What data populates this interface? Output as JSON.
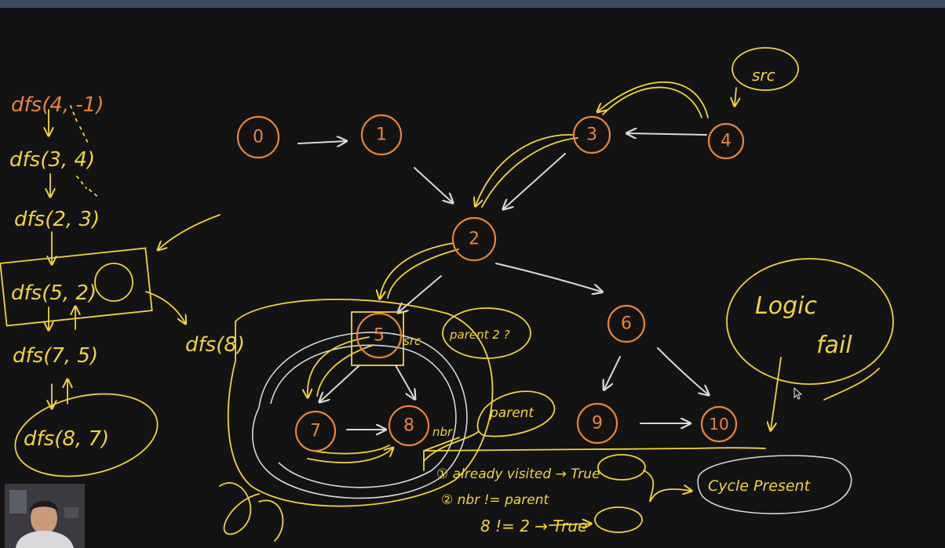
{
  "graph": {
    "nodes": [
      "0",
      "1",
      "2",
      "3",
      "4",
      "5",
      "6",
      "7",
      "8",
      "9",
      "10"
    ]
  },
  "annotations": {
    "src_label": "src",
    "dfs_calls": [
      "dfs(4, -1)",
      "dfs(3, 4)",
      "dfs(2, 3)",
      "dfs(5, 2)",
      "dfs(7, 5)",
      "dfs(8, 7)",
      "dfs(8)"
    ],
    "node5_src": "src",
    "parent_q": "parent 2 ?",
    "nbr_label": "nbr",
    "parent_label": "parent",
    "logic_fail": [
      "Logic",
      "fail"
    ],
    "conditions": [
      "① already visited → True",
      "② nbr != parent",
      "8 != 2 → True"
    ],
    "cycle_present": "Cycle Present"
  },
  "colors": {
    "background": "#131313",
    "node_stroke": "#e8843a",
    "ink_yellow": "#f2d33c",
    "ink_white": "#d8d8d8",
    "titlebar": "#3b4a5e"
  },
  "overlay": {
    "webcam_icon": "webcam-feed",
    "cursor_icon": "mouse-pointer-icon"
  }
}
